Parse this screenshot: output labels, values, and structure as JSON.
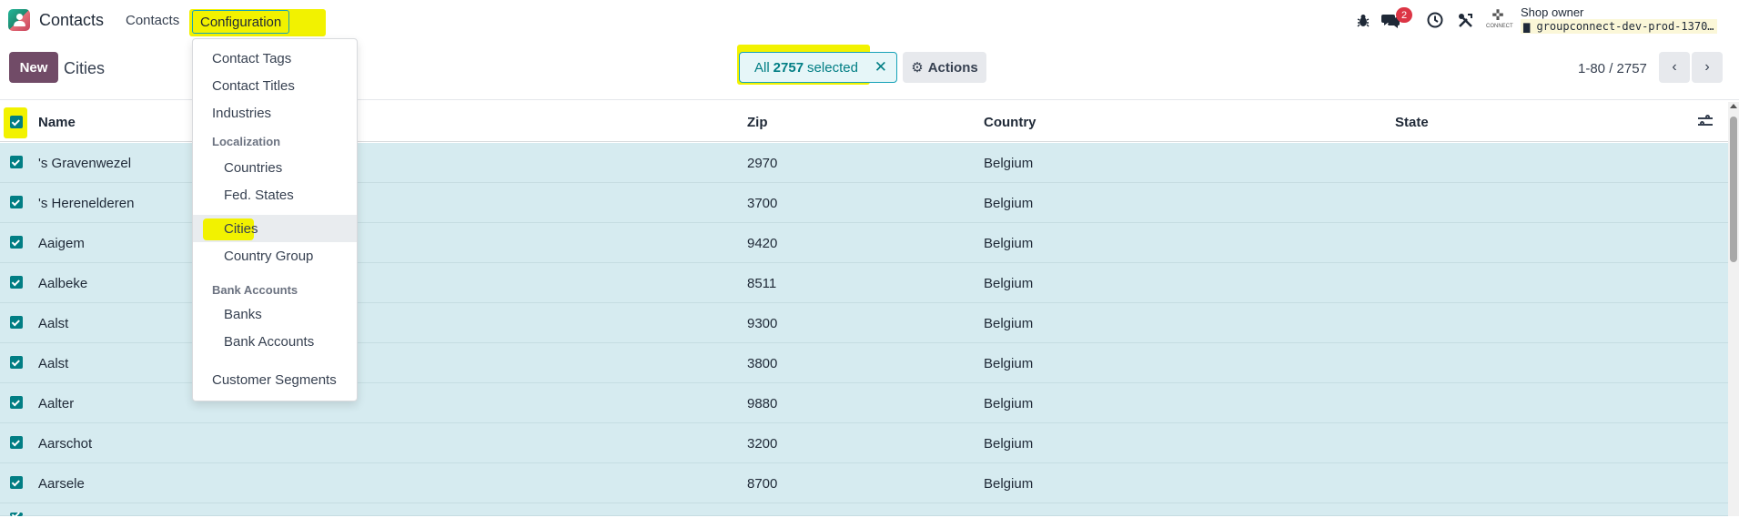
{
  "topbar": {
    "app_name": "Contacts",
    "nav_contacts": "Contacts",
    "nav_configuration": "Configuration",
    "messages_count": "2",
    "user_name": "Shop owner",
    "db_name": "groupconnect-dev-prod-1370…",
    "company_logo_text": "CONNECT"
  },
  "controls": {
    "new_label": "New",
    "page_title": "Cities",
    "selection_prefix": "All",
    "selection_count": "2757",
    "selection_suffix": "selected",
    "actions_label": "Actions",
    "pager_value": "1-80 / 2757"
  },
  "table": {
    "columns": [
      "Name",
      "Zip",
      "Country",
      "State"
    ],
    "rows": [
      {
        "name": "'s Gravenwezel",
        "zip": "2970",
        "country": "Belgium",
        "state": ""
      },
      {
        "name": "'s Herenelderen",
        "zip": "3700",
        "country": "Belgium",
        "state": ""
      },
      {
        "name": "Aaigem",
        "zip": "9420",
        "country": "Belgium",
        "state": ""
      },
      {
        "name": "Aalbeke",
        "zip": "8511",
        "country": "Belgium",
        "state": ""
      },
      {
        "name": "Aalst",
        "zip": "9300",
        "country": "Belgium",
        "state": ""
      },
      {
        "name": "Aalst",
        "zip": "3800",
        "country": "Belgium",
        "state": ""
      },
      {
        "name": "Aalter",
        "zip": "9880",
        "country": "Belgium",
        "state": ""
      },
      {
        "name": "Aarschot",
        "zip": "3200",
        "country": "Belgium",
        "state": ""
      },
      {
        "name": "Aarsele",
        "zip": "8700",
        "country": "Belgium",
        "state": ""
      }
    ]
  },
  "dropdown": {
    "contact_tags": "Contact Tags",
    "contact_titles": "Contact Titles",
    "industries": "Industries",
    "localization_header": "Localization",
    "countries": "Countries",
    "fed_states": "Fed. States",
    "cities": "Cities",
    "country_group": "Country Group",
    "bank_accounts_header": "Bank Accounts",
    "banks": "Banks",
    "bank_accounts": "Bank Accounts",
    "customer_segments": "Customer Segments"
  },
  "colors": {
    "brand": "#714b67",
    "accent": "#017e84",
    "selected_row": "#d6ebf0",
    "highlighter": "#f2f200",
    "badge": "#dc3545"
  }
}
